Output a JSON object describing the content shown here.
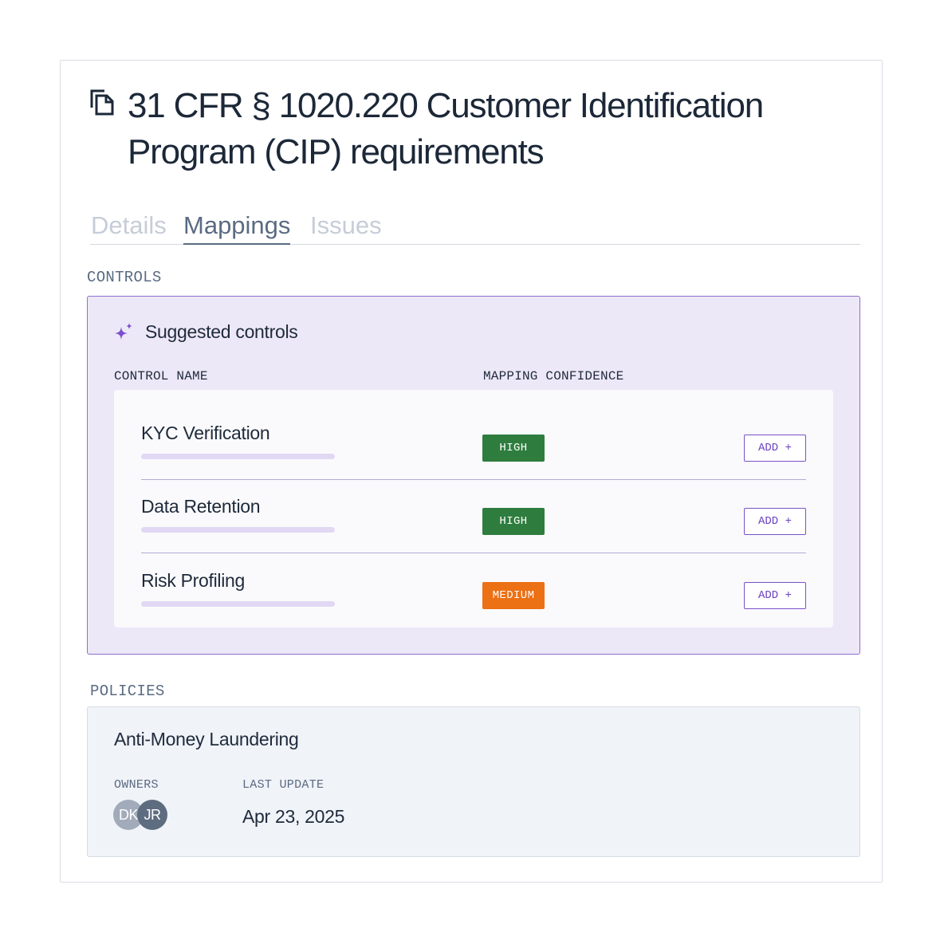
{
  "header": {
    "icon": "copy-icon",
    "title": "31 CFR § 1020.220 Customer Identification Program (CIP) requirements"
  },
  "tabs": [
    {
      "label": "Details",
      "active": false
    },
    {
      "label": "Mappings",
      "active": true
    },
    {
      "label": "Issues",
      "active": false
    }
  ],
  "controls": {
    "section_label": "CONTROLS",
    "suggested": {
      "icon": "sparkle-icon",
      "title": "Suggested controls",
      "column_name": "CONTROL NAME",
      "column_confidence": "MAPPING CONFIDENCE",
      "rows": [
        {
          "name": "KYC Verification",
          "confidence": "HIGH",
          "confidence_color": "#2e7d3e",
          "action": "ADD +"
        },
        {
          "name": "Data Retention",
          "confidence": "HIGH",
          "confidence_color": "#2e7d3e",
          "action": "ADD +"
        },
        {
          "name": "Risk Profiling",
          "confidence": "MEDIUM",
          "confidence_color": "#ec7014",
          "action": "ADD +"
        }
      ]
    }
  },
  "policies": {
    "section_label": "POLICIES",
    "items": [
      {
        "name": "Anti-Money Laundering",
        "owners_label": "OWNERS",
        "owners": [
          {
            "initials": "DK",
            "color": "#a1abba"
          },
          {
            "initials": "JR",
            "color": "#5e6c80"
          }
        ],
        "last_update_label": "LAST UPDATE",
        "last_update": "Apr 23, 2025"
      }
    ]
  },
  "colors": {
    "accent": "#6a3fc0",
    "panel_bg": "#ede8f8",
    "text": "#1e2a3b",
    "muted": "#5a6b82"
  }
}
